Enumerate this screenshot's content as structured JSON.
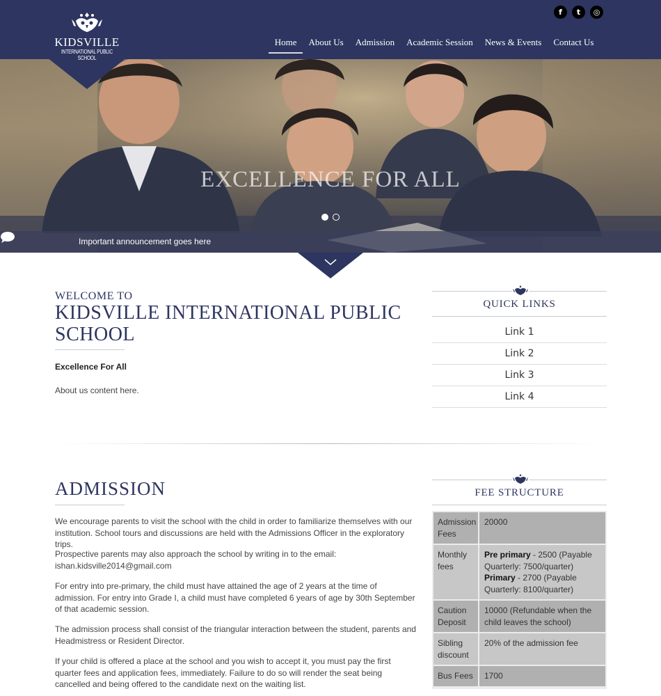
{
  "brand": {
    "name": "KIDSVILLE",
    "subtitle": "INTERNATIONAL PUBLIC SCHOOL"
  },
  "social": {
    "facebook": "f",
    "twitter": "t",
    "instagram": "◎"
  },
  "nav": {
    "items": [
      "Home",
      "About Us",
      "Admission",
      "Academic Session",
      "News & Events",
      "Contact Us"
    ],
    "active": "Home"
  },
  "hero": {
    "headline": "EXCELLENCE FOR ALL",
    "slide_count": 2,
    "active_slide": 1,
    "announcement": "Important announcement goes   here"
  },
  "welcome": {
    "pre": "WELCOME TO",
    "title": "KIDSVILLE INTERNATIONAL PUBLIC SCHOOL",
    "motto": "Excellence For All",
    "about": "About us content here."
  },
  "quick_links": {
    "heading": "QUICK LINKS",
    "items": [
      "Link 1",
      "Link 2",
      "Link 3",
      "Link 4"
    ]
  },
  "admission": {
    "title": "ADMISSION",
    "paragraphs": [
      "We encourage parents to visit the school with the child in order to familiarize themselves with our institution. School tours and discussions are held with the Admissions Officer in the exploratory trips.",
      "Prospective parents may also approach the school by writing in to the email: ishan.kidsville2014@gmail.com",
      "For entry into pre-primary, the child must have attained the age of 2 years at the time of admission. For entry into Grade I, a child must have completed 6 years of age by 30th September of that academic session.",
      "The admission process shall consist of the triangular interaction between the student, parents and Headmistress or Resident Director.",
      "If your child is offered a place at the school and you wish to accept it, you must pay the first quarter fees and application fees, immediately. Failure to do so will render the seat being cancelled and being offered to the candidate next on the waiting list."
    ]
  },
  "fees": {
    "heading": "FEE STRUCTURE",
    "rows": [
      {
        "label": "Admission Fees",
        "value": "20000"
      },
      {
        "label": "Monthly fees",
        "pre_label": "Pre primary",
        "pre_value": " - 2500 (Payable Quarterly: 7500/quarter)",
        "pri_label": "Primary",
        "pri_value": " - 2700 (Payable Quarterly: 8100/quarter)"
      },
      {
        "label": "Caution Deposit",
        "value": "10000 (Refundable when the child leaves the school)"
      },
      {
        "label": "Sibling discount",
        "value": "20% of the admission fee"
      },
      {
        "label": "Bus Fees",
        "value": "1700"
      }
    ]
  },
  "colors": {
    "navy": "#2d3560",
    "white": "#ffffff",
    "cell_dark": "#b0b0b0",
    "cell_light": "#c7c7c7"
  }
}
